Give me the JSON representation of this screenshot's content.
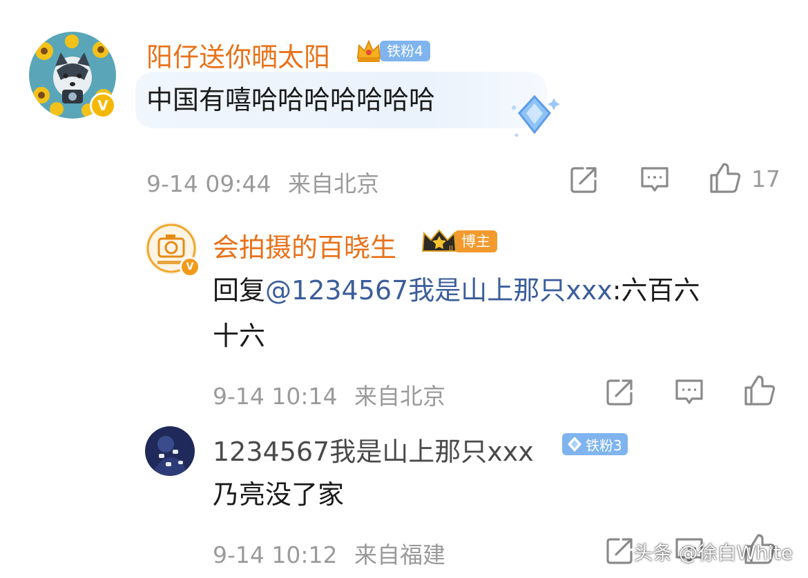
{
  "comments": [
    {
      "username": "阳仔送你晒太阳",
      "badge": "铁粉4",
      "avatar": "sunflower-husky-avatar",
      "text": "中国有嘻哈哈哈哈哈哈哈",
      "time": "9-14 09:44",
      "location": "来自北京",
      "likes": "17"
    },
    {
      "username": "会拍摄的百晓生",
      "badge": "博主",
      "avatar": "camera-logo-avatar",
      "reply_prefix": "回复",
      "mention": "@1234567我是山上那只xxx",
      "text_line1": ":六百六",
      "text_line2": "十六",
      "time": "9-14 10:14",
      "location": "来自北京"
    },
    {
      "username": "1234567我是山上那只xxx",
      "badge": "铁粉3",
      "avatar": "dark-pattern-avatar",
      "text": "乃亮没了家",
      "time": "9-14 10:12",
      "location": "来自福建"
    }
  ],
  "icons": {
    "share": "share-icon",
    "comment": "comment-icon",
    "like": "thumbs-up-icon",
    "verified": "verified-v-icon"
  },
  "colors": {
    "username_orange": "#e8711a",
    "mention_blue": "#3b5d9a",
    "meta_gray": "#9a9a9a",
    "fan_badge_blue": "#7fb4ef",
    "blogger_badge_orange": "#f29a2e"
  },
  "watermark": "头条 @徐白White"
}
